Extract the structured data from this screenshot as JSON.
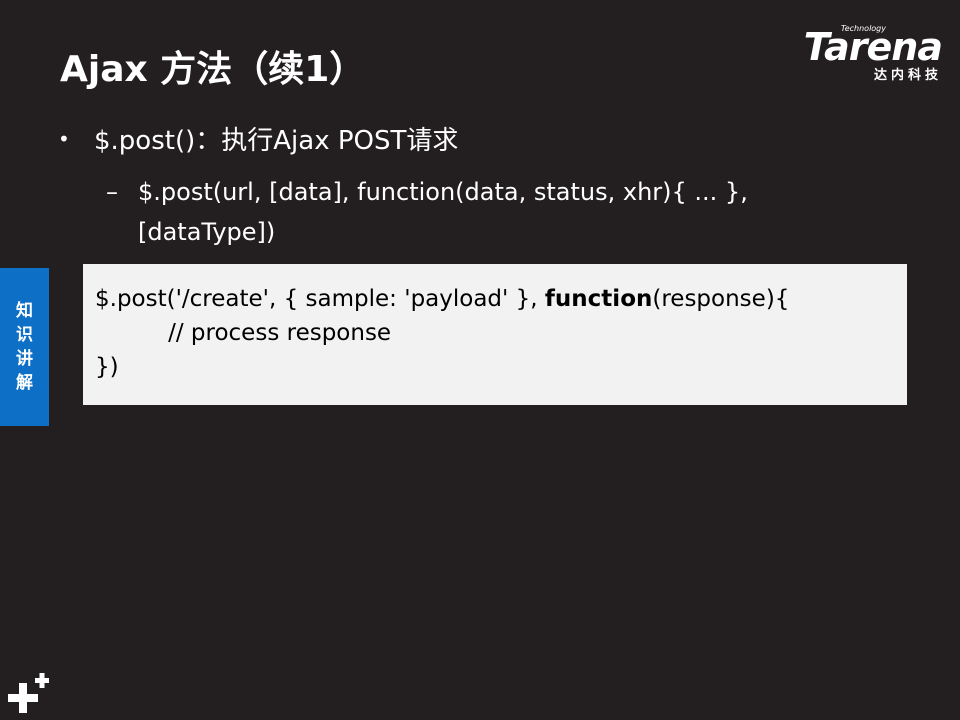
{
  "slide": {
    "title": "Ajax 方法（续1）",
    "logo": {
      "tagline": "Technology",
      "brand": "Tarena",
      "subtitle": "达内科技"
    },
    "bullets": [
      {
        "text": "$.post()：执行Ajax POST请求"
      }
    ],
    "sub_bullets": [
      {
        "dash": "–",
        "line1": "$.post(url, [data], function(data, status, xhr){ ... },",
        "line2": "[dataType])"
      }
    ],
    "side_tab": [
      "知",
      "识",
      "讲",
      "解"
    ],
    "code": {
      "line1_before": "$.post('/create', { sample: 'payload' }, ",
      "line1_keyword": "function",
      "line1_after": "(response){",
      "line2": "          // process response",
      "line3": "})"
    },
    "footer_icon": "plus-plus-icon",
    "colors": {
      "background": "#231f20",
      "side_tab": "#0d6fc6",
      "code_bg": "#f2f2f2"
    }
  }
}
